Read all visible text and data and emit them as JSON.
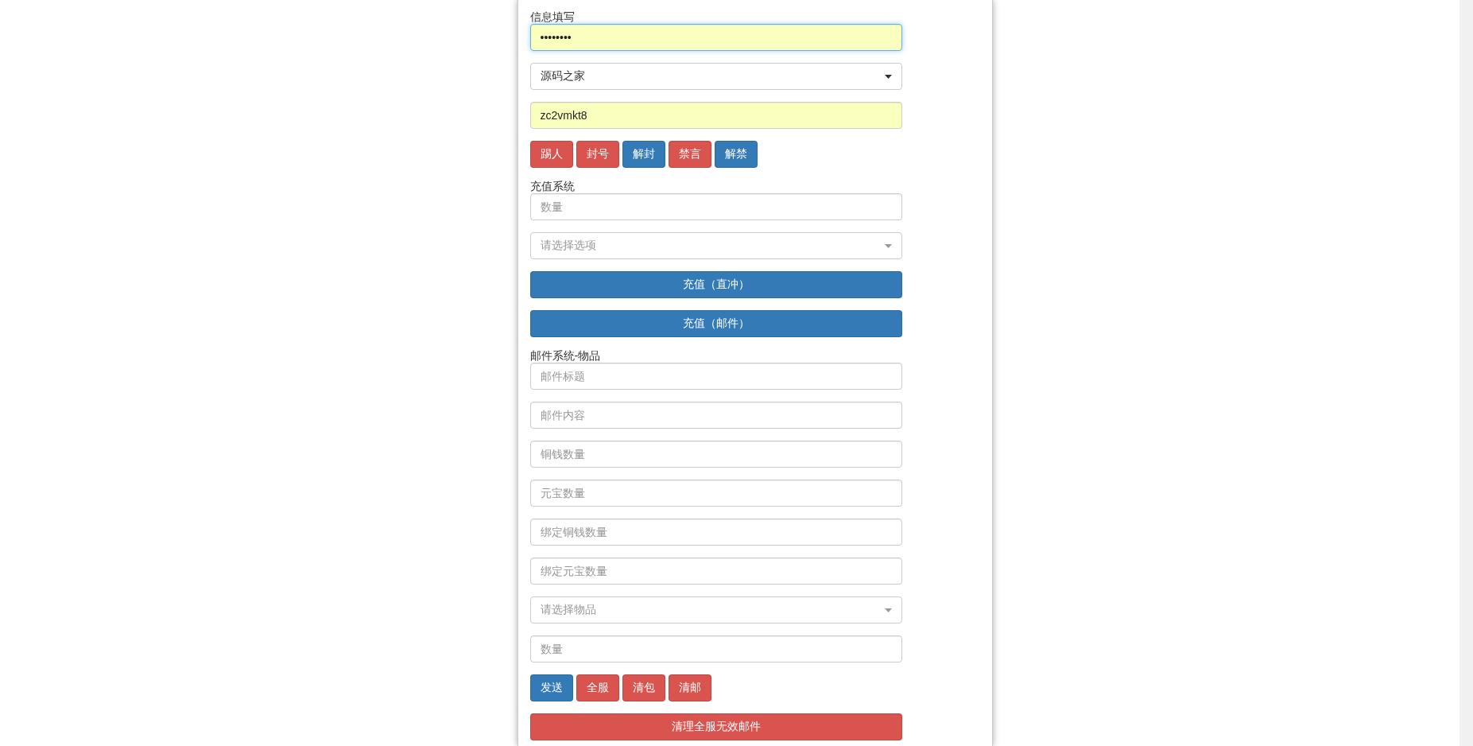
{
  "sections": [
    {
      "title": "信息填写",
      "items": [
        {
          "kind": "input",
          "value": "••••••••",
          "autofilled": true,
          "focused": true
        },
        {
          "kind": "select",
          "value": "源码之家"
        },
        {
          "kind": "input",
          "value": "zc2vmkt8",
          "autofilled": true,
          "focused": false
        },
        {
          "kind": "buttons",
          "buttons": [
            {
              "label": "踢人",
              "color": "#d9534f"
            },
            {
              "label": "封号",
              "color": "#d9534f"
            },
            {
              "label": "解封",
              "color": "#337ab7"
            },
            {
              "label": "禁言",
              "color": "#d9534f"
            },
            {
              "label": "解禁",
              "color": "#337ab7"
            }
          ]
        }
      ]
    },
    {
      "title": "充值系统",
      "items": [
        {
          "kind": "input",
          "placeholder": "数量",
          "autofilled": false,
          "focused": false
        },
        {
          "kind": "select",
          "placeholder": "请选择选项"
        },
        {
          "kind": "block",
          "label": "充值（直冲）",
          "color": "#337ab7"
        },
        {
          "kind": "block",
          "label": "充值（邮件）",
          "color": "#337ab7"
        }
      ]
    },
    {
      "title": "邮件系统-物品",
      "items": [
        {
          "kind": "input",
          "placeholder": "邮件标题",
          "autofilled": false,
          "focused": false
        },
        {
          "kind": "input",
          "placeholder": "邮件内容",
          "autofilled": false,
          "focused": false
        },
        {
          "kind": "input",
          "placeholder": "铜钱数量",
          "autofilled": false,
          "focused": false
        },
        {
          "kind": "input",
          "placeholder": "元宝数量",
          "autofilled": false,
          "focused": false
        },
        {
          "kind": "input",
          "placeholder": "绑定铜钱数量",
          "autofilled": false,
          "focused": false
        },
        {
          "kind": "input",
          "placeholder": "绑定元宝数量",
          "autofilled": false,
          "focused": false
        },
        {
          "kind": "select",
          "placeholder": "请选择物品"
        },
        {
          "kind": "input",
          "placeholder": "数量",
          "autofilled": false,
          "focused": false
        },
        {
          "kind": "buttons",
          "buttons": [
            {
              "label": "发送",
              "color": "#337ab7"
            },
            {
              "label": "全服",
              "color": "#d9534f"
            },
            {
              "label": "清包",
              "color": "#d9534f"
            },
            {
              "label": "清邮",
              "color": "#d9534f"
            }
          ]
        },
        {
          "kind": "block",
          "label": "清理全服无效邮件",
          "color": "#d9534f"
        }
      ]
    }
  ]
}
